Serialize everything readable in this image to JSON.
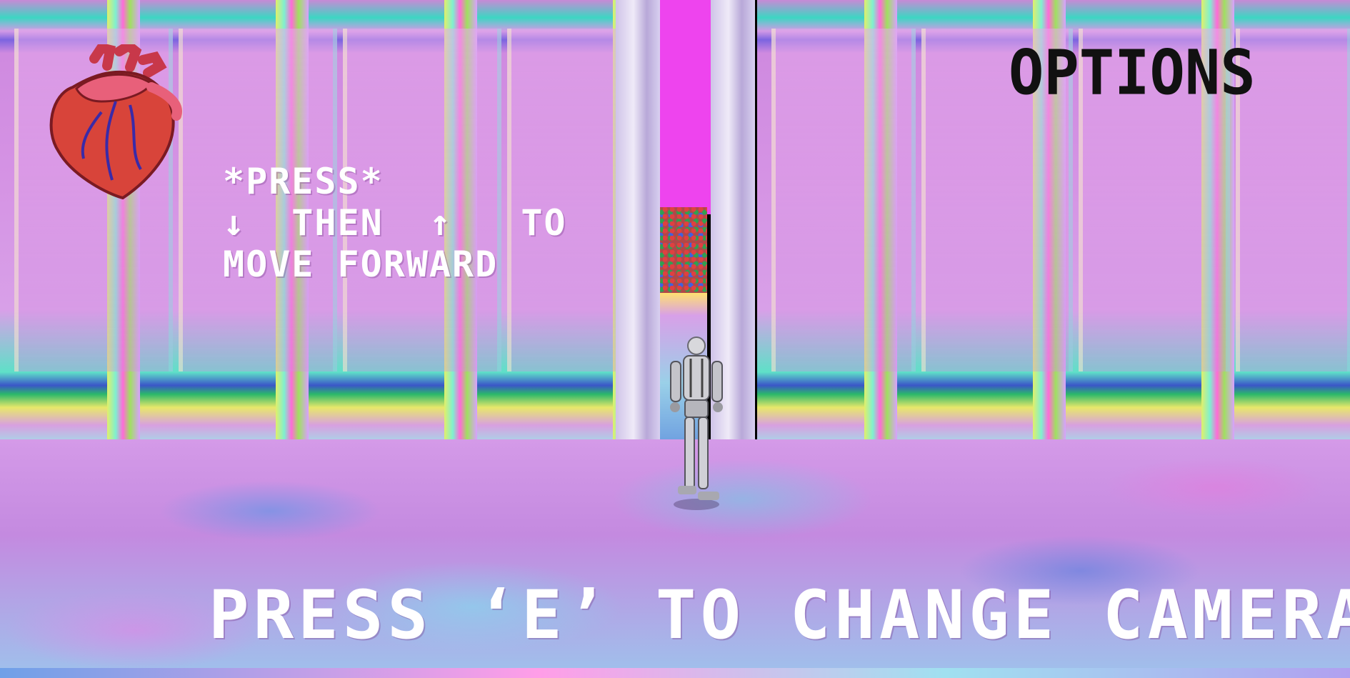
{
  "hud": {
    "hint_lines": [
      "*PRESS*",
      "↓  THEN  ↑   TO",
      "MOVE FORWARD"
    ],
    "options_label": "OPTIONS",
    "camera_hint": "PRESS ‘E’ TO CHANGE CAMERA"
  },
  "icons": {
    "health": "anatomical-heart-icon",
    "player": "robot-character"
  },
  "colors": {
    "wall": "#d593e4",
    "corridor_sky": "#ee44ee",
    "hud_text": "#ffffff",
    "options_text": "#111111",
    "heart": "#d8443a"
  }
}
